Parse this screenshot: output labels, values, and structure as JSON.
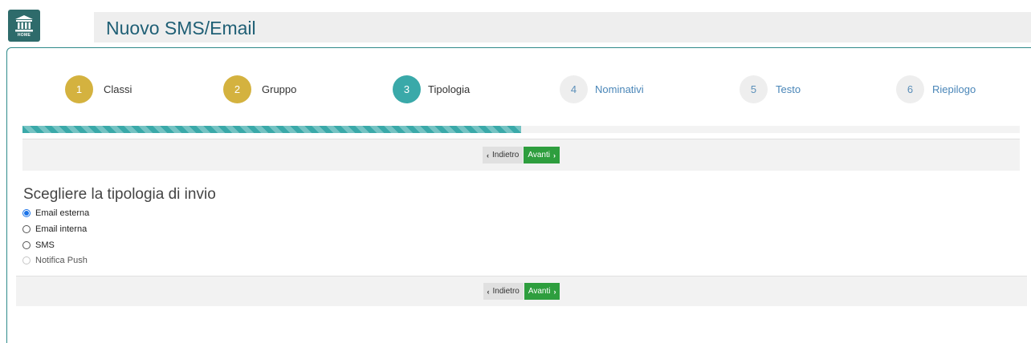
{
  "header": {
    "logo_text": "HOME",
    "title": "Nuovo SMS/Email"
  },
  "wizard": {
    "steps": [
      {
        "number": "1",
        "label": "Classi",
        "state": "done"
      },
      {
        "number": "2",
        "label": "Gruppo",
        "state": "done"
      },
      {
        "number": "3",
        "label": "Tipologia",
        "state": "current"
      },
      {
        "number": "4",
        "label": "Nominativi",
        "state": "todo"
      },
      {
        "number": "5",
        "label": "Testo",
        "state": "todo"
      },
      {
        "number": "6",
        "label": "Riepilogo",
        "state": "todo"
      }
    ],
    "progress_percent": 50
  },
  "nav": {
    "back_label": "Indietro",
    "next_label": "Avanti"
  },
  "content": {
    "title": "Scegliere la tipologia di invio",
    "options": [
      {
        "label": "Email esterna",
        "checked": true,
        "disabled": false
      },
      {
        "label": "Email interna",
        "checked": false,
        "disabled": false
      },
      {
        "label": "SMS",
        "checked": false,
        "disabled": false
      },
      {
        "label": "Notifica Push",
        "checked": false,
        "disabled": true
      }
    ]
  },
  "colors": {
    "accent_teal": "#3aa9a9",
    "step_done": "#d4b23f",
    "next_button": "#2e9e3e",
    "title_blue": "#1f5f75"
  }
}
